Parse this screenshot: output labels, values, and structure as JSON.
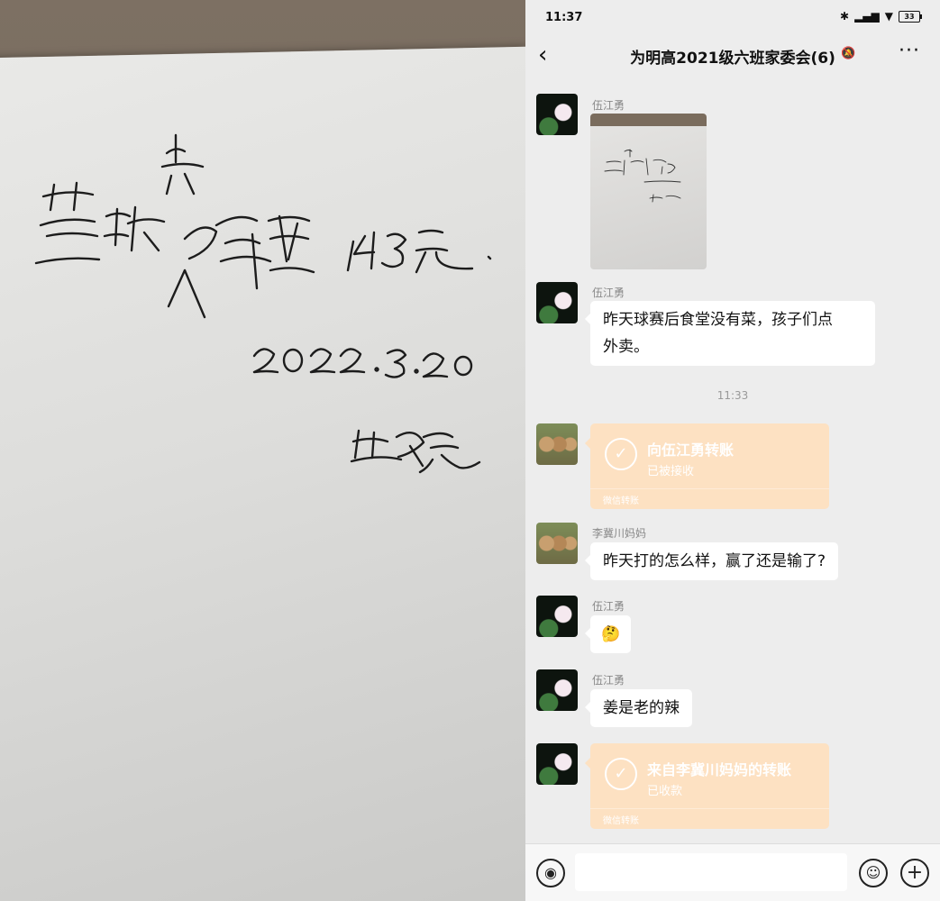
{
  "photo": {
    "handwriting": {
      "line1": "蓝球赛人员餐费 143元",
      "date": "2022.3.20",
      "signature": "晏俊豪"
    }
  },
  "status_bar": {
    "time": "11:37",
    "battery": "33"
  },
  "chat": {
    "title": "为明高2021级六班家委会(6)",
    "messages": [
      {
        "type": "image",
        "sender": "伍江勇",
        "avatar": "lotus-avatar"
      },
      {
        "type": "text",
        "sender": "伍江勇",
        "avatar": "lotus-avatar",
        "line1": "昨天球赛后食堂没有菜，孩子们点",
        "line2": "外卖。"
      },
      {
        "type": "timestamp",
        "text": "11:33"
      },
      {
        "type": "transfer",
        "avatar": "owls-avatar",
        "title": "向伍江勇转账",
        "status": "已被接收",
        "footer": "微信转账"
      },
      {
        "type": "text",
        "sender": "李冀川妈妈",
        "avatar": "owls-avatar",
        "text": "昨天打的怎么样，赢了还是输了?"
      },
      {
        "type": "emoji",
        "sender": "伍江勇",
        "avatar": "lotus-avatar",
        "emoji": "🤔"
      },
      {
        "type": "text",
        "sender": "伍江勇",
        "avatar": "lotus-avatar",
        "text": "姜是老的辣"
      },
      {
        "type": "transfer",
        "avatar": "lotus-avatar",
        "title": "来自李冀川妈妈的转账",
        "status": "已收款",
        "footer": "微信转账"
      }
    ]
  },
  "colors": {
    "chat_bg": "#ededed",
    "transfer_bg": "#fde1c2",
    "bubble_bg": "#ffffff"
  }
}
